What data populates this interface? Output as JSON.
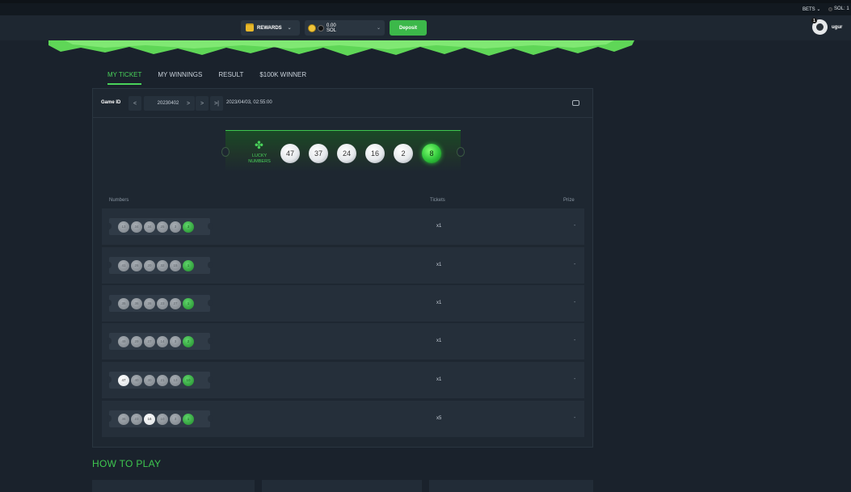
{
  "topbar": {
    "bets_label": "BETS",
    "sol_label": "SOL: 1"
  },
  "header": {
    "rewards_label": "REWARDS",
    "wallet_amount": "0.00",
    "wallet_currency": "SOL",
    "deposit_label": "Deposit",
    "username": "ugur",
    "notification_count": "1"
  },
  "tabs": [
    "MY TICKET",
    "MY WINNINGS",
    "RESULT",
    "$100K WINNER"
  ],
  "panel": {
    "game_id_label": "Game ID",
    "game_id_value": "20230402",
    "game_date": "2023/04/03, 02:55:00",
    "nav_prev": "<",
    "nav_next": ">",
    "nav_next2": ">",
    "nav_last": ">|"
  },
  "lucky": {
    "line1": "LUCKY",
    "line2": "NUMBERS",
    "clover": "✤",
    "numbers": [
      "47",
      "37",
      "24",
      "16",
      "2",
      "8"
    ]
  },
  "columns": {
    "numbers": "Numbers",
    "tickets": "Tickets",
    "prize": "Prize"
  },
  "tickets": [
    {
      "balls": [
        "13",
        "34",
        "34",
        "25",
        "3",
        "3"
      ],
      "hits": [
        false,
        false,
        false,
        false,
        false,
        false
      ],
      "tickets": "x1",
      "prize": "-"
    },
    {
      "balls": [
        "41",
        "26",
        "20",
        "32",
        "15",
        "1"
      ],
      "hits": [
        false,
        false,
        false,
        false,
        false,
        false
      ],
      "tickets": "x1",
      "prize": "-"
    },
    {
      "balls": [
        "35",
        "36",
        "26",
        "23",
        "27",
        "1"
      ],
      "hits": [
        false,
        false,
        false,
        false,
        false,
        false
      ],
      "tickets": "x1",
      "prize": "-"
    },
    {
      "balls": [
        "49",
        "29",
        "27",
        "14",
        "3",
        "2"
      ],
      "hits": [
        false,
        false,
        false,
        false,
        false,
        false
      ],
      "tickets": "x1",
      "prize": "-"
    },
    {
      "balls": [
        "47",
        "40",
        "30",
        "21",
        "13",
        "10"
      ],
      "hits": [
        true,
        false,
        false,
        false,
        false,
        false
      ],
      "tickets": "x1",
      "prize": "-"
    },
    {
      "balls": [
        "36",
        "23",
        "16",
        "10",
        "3",
        "1"
      ],
      "hits": [
        false,
        false,
        true,
        false,
        false,
        false
      ],
      "tickets": "x5",
      "prize": "-"
    }
  ],
  "how_to_play": "HOW TO PLAY",
  "colors": {
    "accent": "#3ec74f",
    "background": "#1a222c",
    "panel": "#1e2731"
  }
}
